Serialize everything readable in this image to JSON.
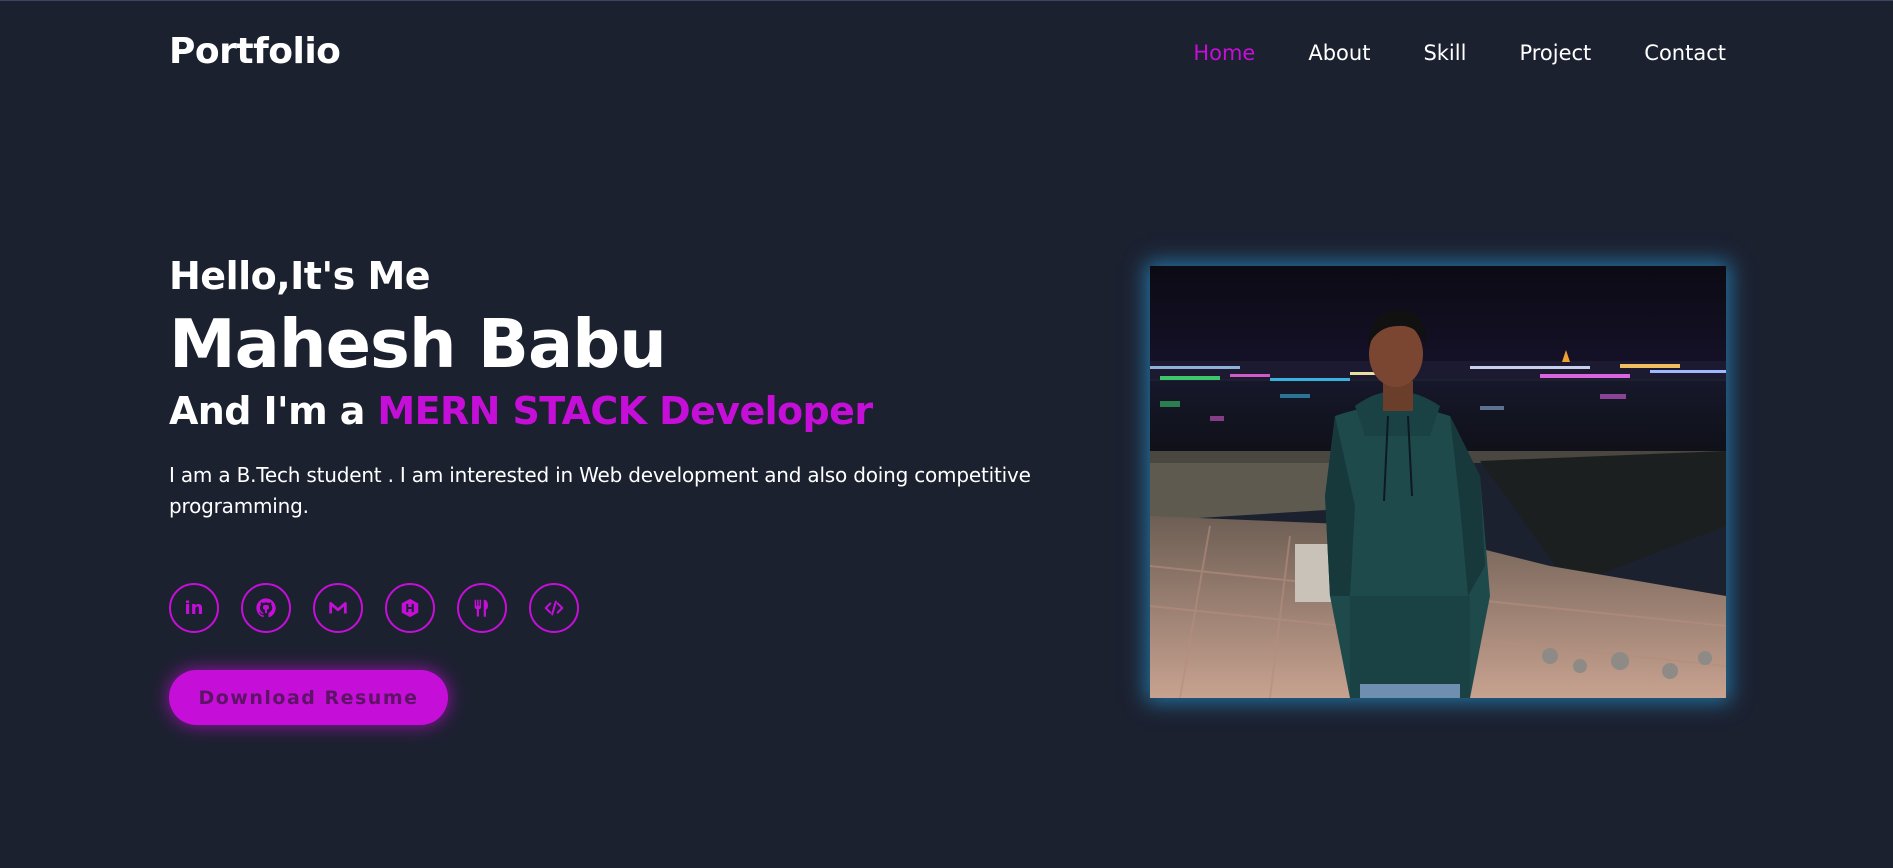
{
  "header": {
    "logo": "Portfolio",
    "nav": [
      {
        "label": "Home",
        "active": true
      },
      {
        "label": "About",
        "active": false
      },
      {
        "label": "Skill",
        "active": false
      },
      {
        "label": "Project",
        "active": false
      },
      {
        "label": "Contact",
        "active": false
      }
    ]
  },
  "hero": {
    "greeting": "Hello,It's Me",
    "name": "Mahesh Babu",
    "role_prefix": "And I'm a ",
    "role_highlight": "MERN STACK Developer",
    "description": "I am a B.Tech student . I am interested in Web development and also doing competitive programming.",
    "resume_button": "Download Resume"
  },
  "socials": [
    {
      "icon": "linkedin-icon",
      "glyph": "in"
    },
    {
      "icon": "github-icon"
    },
    {
      "icon": "gmail-icon"
    },
    {
      "icon": "hackerrank-icon"
    },
    {
      "icon": "codechef-icon"
    },
    {
      "icon": "code-icon"
    }
  ],
  "colors": {
    "background": "#1c2130",
    "accent": "#c50fd8",
    "photo_glow": "#2896d2",
    "text": "#ffffff"
  }
}
